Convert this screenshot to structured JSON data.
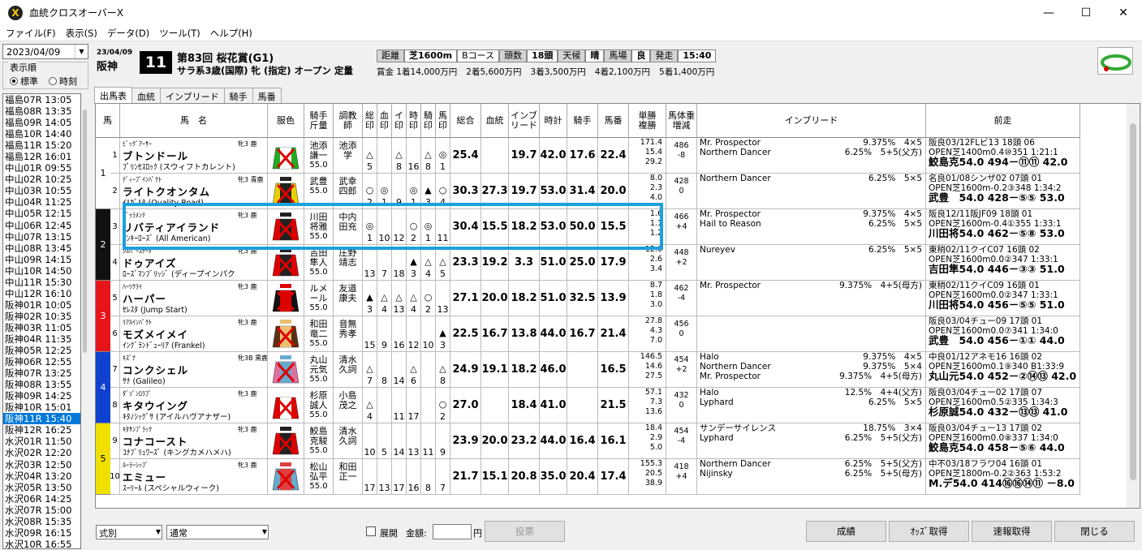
{
  "window": {
    "title": "血統クロスオーバーX",
    "min": "—",
    "max": "☐",
    "close": "✕"
  },
  "menu": [
    "ファイル(F)",
    "表示(S)",
    "データ(D)",
    "ツール(T)",
    "ヘルプ(H)"
  ],
  "left": {
    "date": "2023/04/09",
    "display_label": "表示順",
    "radio_std": "標準",
    "radio_time": "時刻",
    "races": [
      "福島07R 13:05",
      "福島08R 13:35",
      "福島09R 14:05",
      "福島10R 14:40",
      "福島11R 15:20",
      "福島12R 16:01",
      "中山01R 09:55",
      "中山02R 10:25",
      "中山03R 10:55",
      "中山04R 11:25",
      "中山05R 12:15",
      "中山06R 12:45",
      "中山07R 13:15",
      "中山08R 13:45",
      "中山09R 14:15",
      "中山10R 14:50",
      "中山11R 15:30",
      "中山12R 16:10",
      "阪神01R 10:05",
      "阪神02R 10:35",
      "阪神03R 11:05",
      "阪神04R 11:35",
      "阪神05R 12:25",
      "阪神06R 12:55",
      "阪神07R 13:25",
      "阪神08R 13:55",
      "阪神09R 14:25",
      "阪神10R 15:01",
      "阪神11R 15:40",
      "阪神12R 16:25",
      "水沢01R 11:50",
      "水沢02R 12:20",
      "水沢03R 12:50",
      "水沢04R 13:20",
      "水沢05R 13:50",
      "水沢06R 14:25",
      "水沢07R 15:00",
      "水沢08R 15:35",
      "水沢09R 16:15",
      "水沢10R 16:55"
    ],
    "selected_index": 28
  },
  "race": {
    "date": "23/04/09",
    "venue": "阪神",
    "number": "11",
    "name": "第83回 桜花賞(G1)",
    "cond": "サラ系3歳(国際) 牝 (指定) オープン 定量",
    "info": [
      {
        "t": "距離",
        "lab": true
      },
      {
        "t": "芝1600m",
        "b": true
      },
      {
        "t": "Bコース"
      },
      {
        "t": "頭数",
        "lab": true
      },
      {
        "t": "18頭",
        "b": true
      },
      {
        "t": "天候",
        "lab": true
      },
      {
        "t": "晴",
        "b": true
      },
      {
        "t": "馬場",
        "lab": true
      },
      {
        "t": "良",
        "b": true
      },
      {
        "t": "発走",
        "lab": true
      },
      {
        "t": "15:40",
        "b": true
      }
    ],
    "prizes": [
      "賞金 1着14,000万円",
      "2着5,600万円",
      "3着3,500万円",
      "4着2,100万円",
      "5着1,400万円"
    ]
  },
  "tabs": [
    "出馬表",
    "血統",
    "インブリード",
    "騎手",
    "馬番"
  ],
  "columns": [
    "馬",
    "馬　名",
    "服色",
    "騎手\n斤量",
    "調教\n師",
    "総\n印",
    "血\n印",
    "イ\n印",
    "時\n印",
    "騎\n印",
    "馬\n印",
    "総合",
    "血統",
    "インブ\nリード",
    "時計",
    "騎手",
    "馬番",
    "単勝\n複勝",
    "馬体重\n増減",
    "インブリード",
    "前走"
  ],
  "horses": [
    {
      "waku": "1",
      "uma": "1",
      "sire_small": "ﾋﾞｯｸﾞｱｰｻｰ",
      "sex": "牝3 鹿",
      "name": "ブトンドール",
      "dam": "ﾌﾟﾘﾝｾｽﾛｯｸ (スウィフトカレント)",
      "jockey": "池添\n謙一",
      "weight": "55.0",
      "trainer": "池添\n学",
      "marks": [
        "△",
        "",
        "△",
        "",
        "△",
        "◎"
      ],
      "mnums": [
        "5",
        "",
        "8",
        "16",
        "8",
        "1"
      ],
      "total": "25.4",
      "blood": "",
      "inb": "19.7",
      "time": "42.0",
      "jock": "17.6",
      "umaban": "22.4",
      "odds": [
        "171.4",
        "15.4",
        "29.2"
      ],
      "bw": [
        "486",
        "-8"
      ],
      "inbreed": [
        [
          "Mr. Prospector",
          "9.375%　4×5"
        ],
        [
          "Northern Dancer",
          "6.25%　5+5(父方)"
        ]
      ],
      "prev": [
        "阪良03/12FLビ13 18頭 06",
        "OPEN芝1400m0.4⑩351 1:21:1",
        "鮫島克54.0 494－⑪⑪ 42.0"
      ],
      "colors": [
        "#2a2",
        "#fff"
      ]
    },
    {
      "waku": "1",
      "uma": "2",
      "sire_small": "ﾃﾞｨｰﾌﾟｲﾝﾊﾟｸﾄ",
      "sex": "牝3 青鹿",
      "name": "ライトクオンタム",
      "dam": "ｲﾙｶﾞﾙﾀ (Quality Road)",
      "jockey": "武豊",
      "weight": "55.0",
      "trainer": "武幸\n四郎",
      "marks": [
        "○",
        "◎",
        "",
        "◎",
        "▲",
        "○"
      ],
      "mnums": [
        "2",
        "1",
        "9",
        "1",
        "3",
        "4"
      ],
      "total": "30.3",
      "blood": "27.3",
      "inb": "19.7",
      "time": "53.0",
      "jock": "31.4",
      "umaban": "20.0",
      "odds": [
        "8.0",
        "2.3",
        "4.0"
      ],
      "bw": [
        "428",
        "0"
      ],
      "inbreed": [
        [
          "Northern Dancer",
          "6.25%　5×5"
        ]
      ],
      "prev": [
        "名良01/08シンザ02 07頭 01",
        "OPEN芝1600m-0.2③348 1:34:2",
        "武豊　54.0 428－⑤⑤ 53.0"
      ],
      "colors": [
        "#e8d000",
        "#222"
      ]
    },
    {
      "waku": "2",
      "uma": "3",
      "sire_small": "ﾄﾞｩﾗﾒﾝﾃ",
      "sex": "牝3 鹿",
      "name": "リバティアイランド",
      "dam": "ﾔﾝｷｰﾛｰｽﾞ (All American)",
      "jockey": "川田\n将雅",
      "weight": "55.0",
      "trainer": "中内\n田充",
      "marks": [
        "◎",
        "",
        "",
        "○",
        "◎",
        ""
      ],
      "mnums": [
        "1",
        "10",
        "12",
        "2",
        "1",
        "11"
      ],
      "total": "30.4",
      "blood": "15.5",
      "inb": "18.2",
      "time": "53.0",
      "jock": "50.0",
      "umaban": "15.5",
      "odds": [
        "1.6",
        "1.1",
        "1.2"
      ],
      "bw": [
        "466",
        "+4"
      ],
      "inbreed": [
        [
          "Mr. Prospector",
          "9.375%　4×5"
        ],
        [
          "Hail to Reason",
          "6.25%　5×5"
        ]
      ],
      "prev": [
        "阪良12/11阪JF09 18頭 01",
        "OPEN芝1600m-0.4①355 1:33:1",
        "川田将54.0 462－⑤⑧ 53.0"
      ],
      "colors": [
        "#d00",
        "#222"
      ]
    },
    {
      "waku": "2",
      "uma": "4",
      "sire_small": "ｼﾙﾊﾞｰｽﾃｰﾄ",
      "sex": "牝3 鹿",
      "name": "ドゥアイズ",
      "dam": "ﾛｰｽﾞﾏﾝﾌﾞﾘｯｼﾞ (ディープインパク",
      "jockey": "吉田\n隼人",
      "weight": "55.0",
      "trainer": "庄野\n靖志",
      "marks": [
        "",
        "",
        "",
        "▲",
        "△",
        "△"
      ],
      "mnums": [
        "13",
        "7",
        "18",
        "3",
        "4",
        "5"
      ],
      "total": "23.3",
      "blood": "19.2",
      "inb": "3.3",
      "time": "51.0",
      "jock": "25.0",
      "umaban": "17.9",
      "odds": [
        "12.0",
        "2.6",
        "3.4"
      ],
      "bw": [
        "448",
        "+2"
      ],
      "inbreed": [
        [
          "Nureyev",
          "6.25%　5×5"
        ]
      ],
      "prev": [
        "東稍02/11クイC07 16頭 02",
        "OPEN芝1600m0.0②347 1:33:1",
        "吉田隼54.0 446－③③ 51.0"
      ],
      "colors": [
        "#d00",
        "#222"
      ]
    },
    {
      "waku": "3",
      "uma": "5",
      "sire_small": "ﾊｰﾂｸﾗｲ",
      "sex": "牝3 鹿",
      "name": "ハーパー",
      "dam": "ｾﾚｽﾀ (Jump Start)",
      "jockey": "ルメ\nール",
      "weight": "55.0",
      "trainer": "友道\n康夫",
      "marks": [
        "▲",
        "△",
        "△",
        "△",
        "○",
        ""
      ],
      "mnums": [
        "3",
        "4",
        "13",
        "4",
        "2",
        "13"
      ],
      "total": "27.1",
      "blood": "20.0",
      "inb": "18.2",
      "time": "51.0",
      "jock": "32.5",
      "umaban": "13.9",
      "odds": [
        "8.7",
        "1.8",
        "3.0"
      ],
      "bw": [
        "462",
        "-4"
      ],
      "inbreed": [
        [
          "Mr. Prospector",
          "9.375%　4+5(母方)"
        ]
      ],
      "prev": [
        "東稍02/11クイC09 16頭 01",
        "OPEN芝1600m0.0②347 1:33:1",
        "川田将54.0 456－⑤⑤ 51.0"
      ],
      "colors": [
        "#111",
        "#d00"
      ]
    },
    {
      "waku": "3",
      "uma": "6",
      "sire_small": "ﾘｱﾙｲﾝﾊﾟｸﾄ",
      "sex": "牝3 鹿",
      "name": "モズメイメイ",
      "dam": "ｲﾝｸﾞﾗﾝﾄﾞｭｰﾘｱ (Frankel)",
      "jockey": "和田\n竜二",
      "weight": "55.0",
      "trainer": "音無\n秀孝",
      "marks": [
        "",
        "",
        "",
        "",
        "",
        "▲"
      ],
      "mnums": [
        "15",
        "9",
        "16",
        "12",
        "10",
        "3"
      ],
      "total": "22.5",
      "blood": "16.7",
      "inb": "13.8",
      "time": "44.0",
      "jock": "16.7",
      "umaban": "21.4",
      "odds": [
        "27.8",
        "4.3",
        "7.0"
      ],
      "bw": [
        "456",
        "0"
      ],
      "inbreed": [],
      "prev": [
        "阪良03/04チュー09 17頭 01",
        "OPEN芝1600m0.0⑦341 1:34:0",
        "武豊　54.0 456－①① 44.0"
      ],
      "colors": [
        "#5a3010",
        "#e8c070"
      ]
    },
    {
      "waku": "4",
      "uma": "7",
      "sire_small": "ｷｽﾞﾅ",
      "sex": "牝3B 黒鹿",
      "name": "コンクシェル",
      "dam": "ｻﾅ (Galileo)",
      "jockey": "丸山\n元気",
      "weight": "55.0",
      "trainer": "清水\n久詞",
      "marks": [
        "△",
        "",
        "",
        "△",
        "",
        "△"
      ],
      "mnums": [
        "7",
        "8",
        "14",
        "6",
        "",
        "8"
      ],
      "total": "24.9",
      "blood": "19.1",
      "inb": "18.2",
      "time": "46.0",
      "jock": "",
      "umaban": "16.5",
      "odds": [
        "146.5",
        "14.6",
        "27.5"
      ],
      "bw": [
        "454",
        "+2"
      ],
      "inbreed": [
        [
          "Halo",
          "9.375%　4×5"
        ],
        [
          "Northern Dancer",
          "9.375%　5×4"
        ],
        [
          "Mr. Prospector",
          "9.375%　4+5(母方)"
        ]
      ],
      "prev": [
        "中良01/12アネモ16 16頭 02",
        "OPEN芝1600m0.1⑨340 B1:33:9",
        "丸山元54.0 452－②⑭⑬ 42.0"
      ],
      "colors": [
        "#e070a0",
        "#6ac"
      ]
    },
    {
      "waku": "4",
      "uma": "8",
      "sire_small": "ﾀﾞｿﾞﾝﾛﾗﾌﾞ",
      "sex": "牝3 鹿",
      "name": "キタウイング",
      "dam": "ｷﾀﾉｼｯｸﾞｻ (アイルハヴアナザー)",
      "jockey": "杉原\n誠人",
      "weight": "55.0",
      "trainer": "小島\n茂之",
      "marks": [
        "△",
        "",
        "",
        "",
        "",
        "○"
      ],
      "mnums": [
        "4",
        "",
        "11",
        "17",
        "",
        "2"
      ],
      "total": "27.0",
      "blood": "",
      "inb": "18.4",
      "time": "41.0",
      "jock": "",
      "umaban": "21.5",
      "odds": [
        "57.1",
        "7.3",
        "13.6"
      ],
      "bw": [
        "432",
        "0"
      ],
      "inbreed": [
        [
          "Halo",
          "12.5%　4+4(父方)"
        ],
        [
          "Lyphard",
          "6.25%　5×5"
        ]
      ],
      "prev": [
        "阪良03/04チュー02 17頭 07",
        "OPEN芝1600m0.5②335 1:34:3",
        "杉原誠54.0 432－⑬⑬ 41.0"
      ],
      "colors": [
        "#d00",
        "#fff"
      ]
    },
    {
      "waku": "5",
      "uma": "9",
      "sire_small": "ｷﾀｻﾝﾌﾞﾗｯｸ",
      "sex": "牝3 鹿",
      "name": "コナコースト",
      "dam": "ｺﾅﾌﾞﾘｭﾜｰｽﾞ (キングカメハメハ)",
      "jockey": "鮫島\n克駿",
      "weight": "55.0",
      "trainer": "清水\n久詞",
      "marks": [
        "",
        "",
        "",
        "",
        "",
        ""
      ],
      "mnums": [
        "10",
        "5",
        "14",
        "13",
        "11",
        "9"
      ],
      "total": "23.9",
      "blood": "20.0",
      "inb": "23.2",
      "time": "44.0",
      "jock": "16.4",
      "umaban": "16.1",
      "odds": [
        "18.4",
        "2.9",
        "5.0"
      ],
      "bw": [
        "454",
        "-4"
      ],
      "inbreed": [
        [
          "サンデーサイレンス",
          "18.75%　3×4"
        ],
        [
          "Lyphard",
          "6.25%　5+5(父方)"
        ]
      ],
      "prev": [
        "阪良03/04チュー13 17頭 02",
        "OPEN芝1600m0.0⑧337 1:34:0",
        "鮫島克54.0 458－⑤⑥ 44.0"
      ],
      "colors": [
        "#d00",
        "#222"
      ]
    },
    {
      "waku": "5",
      "uma": "10",
      "sire_small": "ﾙｰﾗｰｼｯﾌﾟ",
      "sex": "牝3 鹿",
      "name": "エミュー",
      "dam": "ｽｰﾘｰﾙ (スペシャルウィーク)",
      "jockey": "松山\n弘平",
      "weight": "55.0",
      "trainer": "和田\n正一",
      "marks": [
        "",
        "",
        "",
        "",
        "",
        ""
      ],
      "mnums": [
        "17",
        "13",
        "17",
        "16",
        "8",
        "7"
      ],
      "total": "21.7",
      "blood": "15.1",
      "inb": "20.8",
      "time": "35.0",
      "jock": "20.4",
      "umaban": "17.4",
      "odds": [
        "155.3",
        "20.5",
        "38.9"
      ],
      "bw": [
        "418",
        "+4"
      ],
      "inbreed": [
        [
          "Northern Dancer",
          "6.25%　5+5(父方)"
        ],
        [
          "Nijinsky",
          "6.25%　5+5(母方)"
        ]
      ],
      "prev": [
        "中不03/18フラワ04 16頭 01",
        "OPEN芝1800m-0.2②363 1:53:2",
        "M.デ54.0 414⑯⑯⑭⑪ －8.0"
      ],
      "colors": [
        "#6ac",
        "#e04040"
      ]
    }
  ],
  "waku_colors": {
    "1": "#ffffff",
    "2": "#111111",
    "3": "#e8141c",
    "4": "#1040d0",
    "5": "#f0e000"
  },
  "bottom": {
    "kind": "式別",
    "mode": "通常",
    "tenkai": "展開",
    "amount_label": "金額:",
    "yen": "円",
    "vote": "投票",
    "b1": "成績",
    "b2": "ｵｯｽﾞ取得",
    "b3": "速報取得",
    "b4": "閉じる"
  }
}
